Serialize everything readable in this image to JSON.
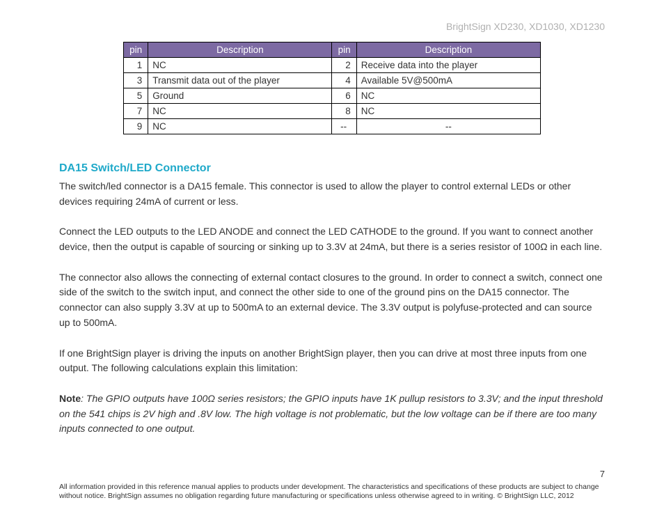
{
  "header": {
    "product_line": "BrightSign XD230, XD1030, XD1230"
  },
  "table": {
    "headers": {
      "pin_a": "pin",
      "desc_a": "Description",
      "pin_b": "pin",
      "desc_b": "Description"
    },
    "rows": [
      {
        "pa": "1",
        "da": "NC",
        "pb": "2",
        "db": "Receive data into the player"
      },
      {
        "pa": "3",
        "da": "Transmit data out of the player",
        "pb": "4",
        "db": "Available 5V@500mA"
      },
      {
        "pa": "5",
        "da": "Ground",
        "pb": "6",
        "db": "NC"
      },
      {
        "pa": "7",
        "da": "NC",
        "pb": "8",
        "db": "NC"
      },
      {
        "pa": "9",
        "da": "NC",
        "pb": "--",
        "db": "--"
      }
    ]
  },
  "section": {
    "title": "DA15 Switch/LED Connector"
  },
  "paragraphs": {
    "p1": "The switch/led connector is a DA15 female. This connector is used to allow the player to control external LEDs or other devices requiring 24mA of current or less.",
    "p2": "Connect the LED outputs to the LED ANODE and connect the LED CATHODE to the ground. If you want to connect another device, then the output is capable of sourcing or sinking up to 3.3V at 24mA, but there is a series resistor of 100Ω in each line.",
    "p3": "The connector also allows the connecting of external contact closures to the ground. In order to connect a switch, connect one side of the switch to the switch input, and connect the other side to one of the ground pins on the DA15 connector. The connector can also supply 3.3V at up to 500mA to an external device. The 3.3V output is polyfuse-protected and can source up to 500mA.",
    "p4": "If one BrightSign player is driving the inputs on another BrightSign player, then you can drive at most three inputs from one output. The following calculations explain this limitation:"
  },
  "note": {
    "label": "Note",
    "text": ": The GPIO outputs have 100Ω series resistors; the GPIO inputs have 1K pullup resistors to 3.3V; and the input threshold on the 541 chips is 2V high and .8V low. The high voltage is not problematic, but the low voltage can be if there are too many inputs connected to one output."
  },
  "footer": {
    "page": "7",
    "disclaimer": "All information provided in this reference manual applies to products under development. The characteristics and specifications of these products are subject to change without notice. BrightSign assumes no obligation regarding future manufacturing or specifications unless otherwise agreed to in writing. © BrightSign LLC, 2012"
  }
}
